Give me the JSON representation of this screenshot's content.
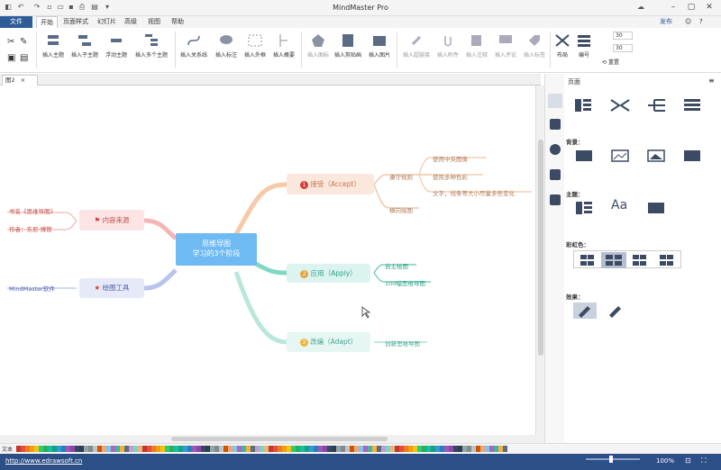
{
  "app": {
    "title": "MindMaster Pro"
  },
  "menu": {
    "tabs": [
      "文件",
      "开始",
      "页面样式",
      "幻灯片",
      "高级",
      "视图",
      "帮助"
    ],
    "active": "开始",
    "publish": "发布"
  },
  "ribbon": {
    "buttons": [
      "插入主题",
      "插入子主题",
      "浮动主题",
      "插入多个主题",
      "插入关系线",
      "插入标注",
      "插入外框",
      "插入概要",
      "插入图标",
      "插入剪贴画",
      "插入图片",
      "插入超链接",
      "插入附件",
      "插入注释",
      "插入评论",
      "插入标签",
      "布局",
      "编号",
      "重置"
    ],
    "spin1": "30",
    "spin2": "30"
  },
  "doc": {
    "tab_label": "图2"
  },
  "mindmap": {
    "center": "思维导图\n学习的3个阶段",
    "b1_num": "1",
    "b1": "接受（Accept）",
    "b1_sub": "遵守规则",
    "b1_leaf1": "使用中央图像",
    "b1_leaf2": "使用多种色彩",
    "b1_leaf3": "文字，线条等大小尽量多些变化",
    "b1_leaf4": "横向绘图",
    "b2_num": "2",
    "b2": "应用（Apply）",
    "b2_leaf1": "自主绘图",
    "b2_leaf2": "100幅思维导图",
    "b3_num": "3",
    "b3": "改编（Adapt）",
    "b3_leaf1": "创新思维导图",
    "l1": "内容来源",
    "l1_leaf1": "书名《思维导图》",
    "l1_leaf2": "作者：东尼·博赞",
    "l2": "绘图工具",
    "l2_leaf1": "MindMaster软件"
  },
  "panel": {
    "title": "页面",
    "section_bg": "背景：",
    "section_theme": "主题：",
    "section_color": "彩虹色：",
    "section_effect": "效果："
  },
  "palette": {
    "label": "文本"
  },
  "status": {
    "url": "http://www.edrawsoft.cn",
    "zoom": "100%"
  },
  "colors": {
    "accent": "#2f5c99",
    "center_bg": "#6fbaf2",
    "orange": "#f6c9a8",
    "green": "#7fd8c4",
    "red": "#f5b5b5",
    "purple": "#b8c3ee"
  }
}
